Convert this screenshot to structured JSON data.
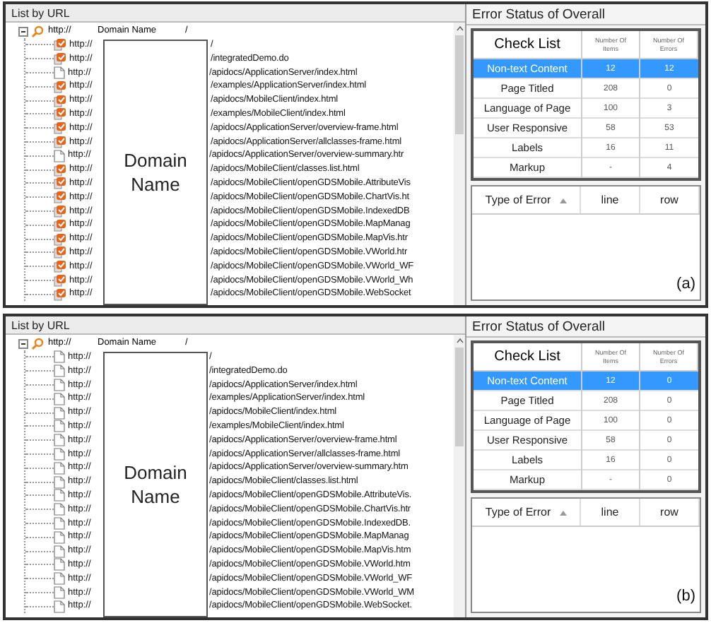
{
  "panels": [
    {
      "label": "(a)",
      "list_title": "List by URL",
      "root": {
        "expanded": true,
        "prefix": "http://",
        "domain": "Domain Name",
        "suffix": "/"
      },
      "overlay_label": "Domain Name",
      "rows": [
        {
          "kind": "error",
          "prefix": "http://",
          "path": "/"
        },
        {
          "kind": "error",
          "prefix": "http://",
          "path": "/integratedDemo.do"
        },
        {
          "kind": "page",
          "prefix": "http://",
          "path": "/apidocs/ApplicationServer/index.html"
        },
        {
          "kind": "error",
          "prefix": "http://",
          "path": "/examples/ApplicationServer/index.html"
        },
        {
          "kind": "error",
          "prefix": "http://",
          "path": "/apidocs/MobileClient/index.html"
        },
        {
          "kind": "error",
          "prefix": "http://",
          "path": "/examples/MobileClient/index.html"
        },
        {
          "kind": "error",
          "prefix": "http://",
          "path": "/apidocs/ApplicationServer/overview-frame.html"
        },
        {
          "kind": "error",
          "prefix": "http://",
          "path": "/apidocs/ApplicationServer/allclasses-frame.html"
        },
        {
          "kind": "page",
          "prefix": "http://",
          "path": "/apidocs/ApplicationServer/overview-summary.htr"
        },
        {
          "kind": "error",
          "prefix": "http://",
          "path": "/apidocs/MobileClient/classes.list.html"
        },
        {
          "kind": "error",
          "prefix": "http://",
          "path": "/apidocs/MobileClient/openGDSMobile.AttributeVis"
        },
        {
          "kind": "error",
          "prefix": "http://",
          "path": "/apidocs/MobileClient/openGDSMobile.ChartVis.ht"
        },
        {
          "kind": "error",
          "prefix": "http://",
          "path": "/apidocs/MobileClient/openGDSMobile.IndexedDB"
        },
        {
          "kind": "error",
          "prefix": "http://",
          "path": "/apidocs/MobileClient/openGDSMobile.MapManag"
        },
        {
          "kind": "error",
          "prefix": "http://",
          "path": "/apidocs/MobileClient/openGDSMobile.MapVis.htr"
        },
        {
          "kind": "error",
          "prefix": "http://",
          "path": "/apidocs/MobileClient/openGDSMobile.VWorld.htr"
        },
        {
          "kind": "error",
          "prefix": "http://",
          "path": "/apidocs/MobileClient/openGDSMobile.VWorld_WF"
        },
        {
          "kind": "error",
          "prefix": "http://",
          "path": "/apidocs/MobileClient/openGDSMobile.VWorld_Wh"
        },
        {
          "kind": "error",
          "prefix": "http://",
          "path": "/apidocs/MobileClient/openGDSMobile.WebSocket"
        }
      ],
      "status_title": "Error Status of Overall",
      "check_table": {
        "columns": [
          "Check List",
          "Number Of Items",
          "Number Of Errors"
        ],
        "rows": [
          {
            "item": "Non-text Content",
            "items": "12",
            "errors": "12",
            "selected": true
          },
          {
            "item": "Page Titled",
            "items": "208",
            "errors": "0",
            "selected": false
          },
          {
            "item": "Language of Page",
            "items": "100",
            "errors": "3",
            "selected": false
          },
          {
            "item": "User Responsive",
            "items": "58",
            "errors": "53",
            "selected": false
          },
          {
            "item": "Labels",
            "items": "16",
            "errors": "11",
            "selected": false
          },
          {
            "item": "Markup",
            "items": "-",
            "errors": "4",
            "selected": false
          }
        ]
      },
      "error_table": {
        "columns": [
          "Type of Error",
          "line",
          "row"
        ]
      }
    },
    {
      "label": "(b)",
      "list_title": "List by URL",
      "root": {
        "expanded": true,
        "prefix": "http://",
        "domain": "Domain Name",
        "suffix": "/"
      },
      "overlay_label": "Domain Name",
      "rows": [
        {
          "kind": "page",
          "prefix": "http://",
          "path": "/"
        },
        {
          "kind": "page",
          "prefix": "http://",
          "path": "/integratedDemo.do"
        },
        {
          "kind": "page",
          "prefix": "http://",
          "path": "/apidocs/ApplicationServer/index.html"
        },
        {
          "kind": "page",
          "prefix": "http://",
          "path": "/examples/ApplicationServer/index.html"
        },
        {
          "kind": "page",
          "prefix": "http://",
          "path": "/apidocs/MobileClient/index.html"
        },
        {
          "kind": "page",
          "prefix": "http://",
          "path": "/examples/MobileClient/index.html"
        },
        {
          "kind": "page",
          "prefix": "http://",
          "path": "/apidocs/ApplicationServer/overview-frame.html"
        },
        {
          "kind": "page",
          "prefix": "http://",
          "path": "/apidocs/ApplicationServer/allclasses-frame.html"
        },
        {
          "kind": "page",
          "prefix": "http://",
          "path": "/apidocs/ApplicationServer/overview-summary.htm"
        },
        {
          "kind": "page",
          "prefix": "http://",
          "path": "/apidocs/MobileClient/classes.list.html"
        },
        {
          "kind": "page",
          "prefix": "http://",
          "path": "/apidocs/MobileClient/openGDSMobile.AttributeVis."
        },
        {
          "kind": "page",
          "prefix": "http://",
          "path": "/apidocs/MobileClient/openGDSMobile.ChartVis.htr"
        },
        {
          "kind": "page",
          "prefix": "http://",
          "path": "/apidocs/MobileClient/openGDSMobile.IndexedDB."
        },
        {
          "kind": "page",
          "prefix": "http://",
          "path": "/apidocs/MobileClient/openGDSMobile.MapManag"
        },
        {
          "kind": "page",
          "prefix": "http://",
          "path": "/apidocs/MobileClient/openGDSMobile.MapVis.htm"
        },
        {
          "kind": "page",
          "prefix": "http://",
          "path": "/apidocs/MobileClient/openGDSMobile.VWorld.htm"
        },
        {
          "kind": "page",
          "prefix": "http://",
          "path": "/apidocs/MobileClient/openGDSMobile.VWorld_WF"
        },
        {
          "kind": "page",
          "prefix": "http://",
          "path": "/apidocs/MobileClient/openGDSMobile.VWorld_WM"
        },
        {
          "kind": "page",
          "prefix": "http://",
          "path": "/apidocs/MobileClient/openGDSMobile.WebSocket."
        }
      ],
      "status_title": "Error Status of Overall",
      "check_table": {
        "columns": [
          "Check List",
          "Number Of Items",
          "Number Of Errors"
        ],
        "rows": [
          {
            "item": "Non-text Content",
            "items": "12",
            "errors": "0",
            "selected": true
          },
          {
            "item": "Page Titled",
            "items": "208",
            "errors": "0",
            "selected": false
          },
          {
            "item": "Language of Page",
            "items": "100",
            "errors": "0",
            "selected": false
          },
          {
            "item": "User Responsive",
            "items": "58",
            "errors": "0",
            "selected": false
          },
          {
            "item": "Labels",
            "items": "16",
            "errors": "0",
            "selected": false
          },
          {
            "item": "Markup",
            "items": "-",
            "errors": "0",
            "selected": false
          }
        ]
      },
      "error_table": {
        "columns": [
          "Type of Error",
          "line",
          "row"
        ]
      }
    }
  ]
}
